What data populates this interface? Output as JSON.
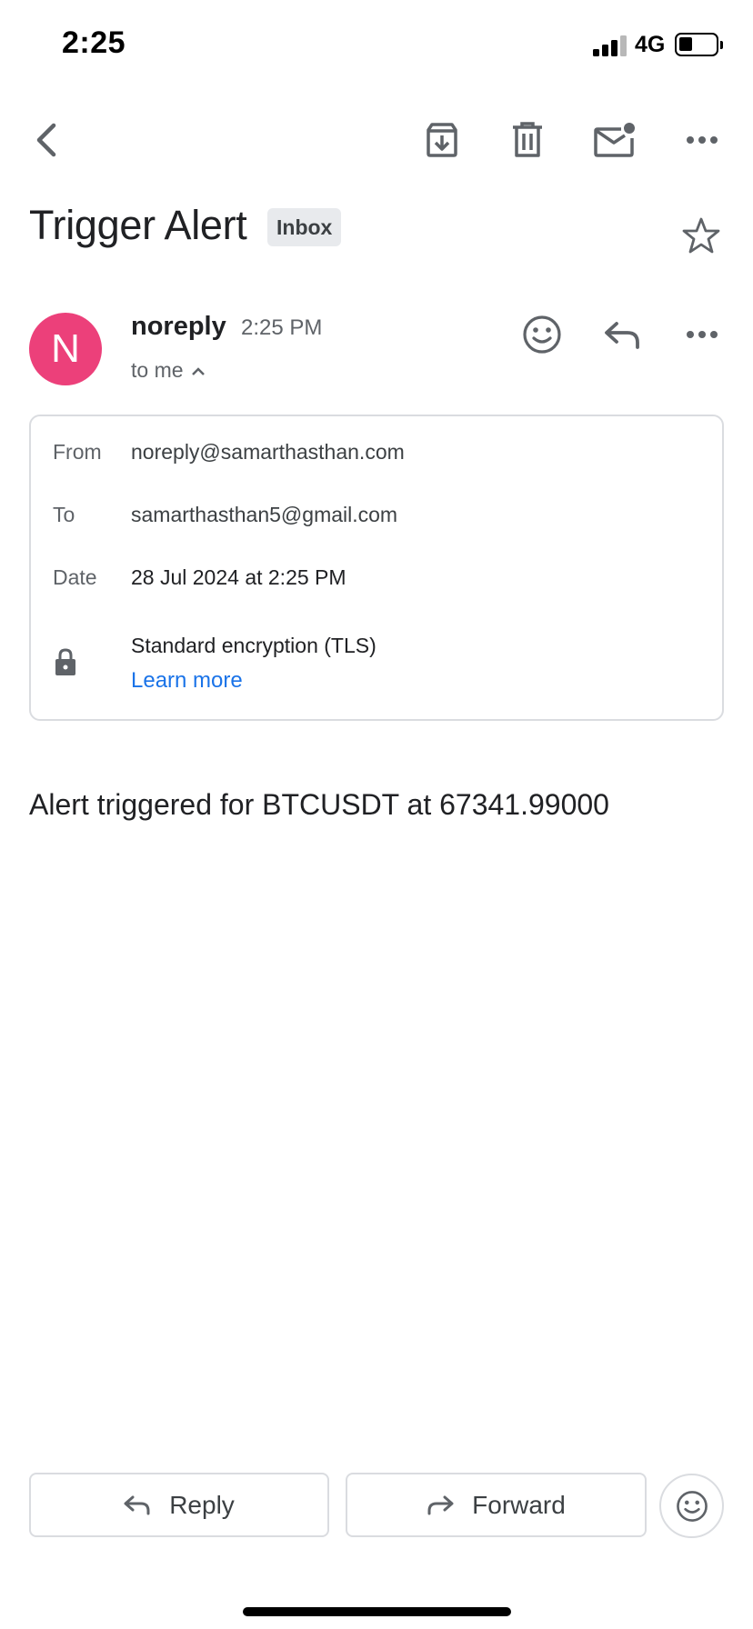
{
  "status_bar": {
    "time": "2:25",
    "network": "4G"
  },
  "toolbar": {
    "icons": [
      "back-arrow-icon",
      "archive-icon",
      "trash-icon",
      "mark-unread-icon",
      "more-horizontal-icon"
    ]
  },
  "email": {
    "subject": "Trigger Alert",
    "label": "Inbox",
    "sender": {
      "initial": "N",
      "name": "noreply",
      "time": "2:25 PM",
      "recipients": "to me",
      "avatar_color": "#ec407a"
    },
    "details": {
      "from_label": "From",
      "from_value": "noreply@samarthasthan.com",
      "to_label": "To",
      "to_value": "samarthasthan5@gmail.com",
      "date_label": "Date",
      "date_value": "28 Jul 2024 at 2:25 PM",
      "security_text": "Standard encryption (TLS)",
      "learn_more": "Learn more"
    },
    "body": "Alert triggered for BTCUSDT at 67341.99000"
  },
  "actions": {
    "reply_label": "Reply",
    "forward_label": "Forward"
  },
  "colors": {
    "accent_link": "#1a73e8",
    "icon_gray": "#5f6368",
    "border": "#dadce0"
  }
}
